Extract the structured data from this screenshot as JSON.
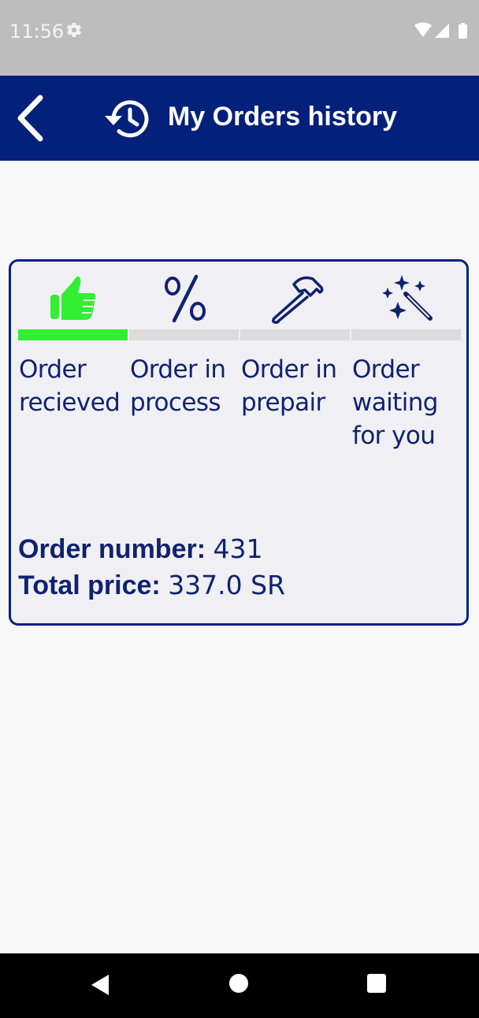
{
  "status_bar": {
    "time": "11:56",
    "icons": [
      "settings-icon",
      "wifi-icon",
      "signal-icon",
      "battery-icon"
    ]
  },
  "app_bar": {
    "title": "My Orders history",
    "back_icon": "chevron-left-icon",
    "title_icon": "history-icon",
    "background": "#03207a"
  },
  "order": {
    "steps": [
      {
        "label": "Order recieved",
        "icon": "thumbs-up-icon",
        "active": true
      },
      {
        "label": "Order in process",
        "icon": "percent-icon",
        "active": false
      },
      {
        "label": "Order in prepair",
        "icon": "hammer-icon",
        "active": false
      },
      {
        "label": "Order waiting for you",
        "icon": "magic-wand-icon",
        "active": false
      }
    ],
    "number_label": "Order number:",
    "number_value": "431",
    "price_label": "Total price:",
    "price_value": "337.0 SR"
  },
  "colors": {
    "accent": "#03207a",
    "active_step": "#33ee33",
    "inactive_step": "#dcdcdc",
    "text": "#10226f"
  },
  "nav_bar": {
    "icons": [
      "back-triangle-icon",
      "home-circle-icon",
      "recents-square-icon"
    ]
  }
}
